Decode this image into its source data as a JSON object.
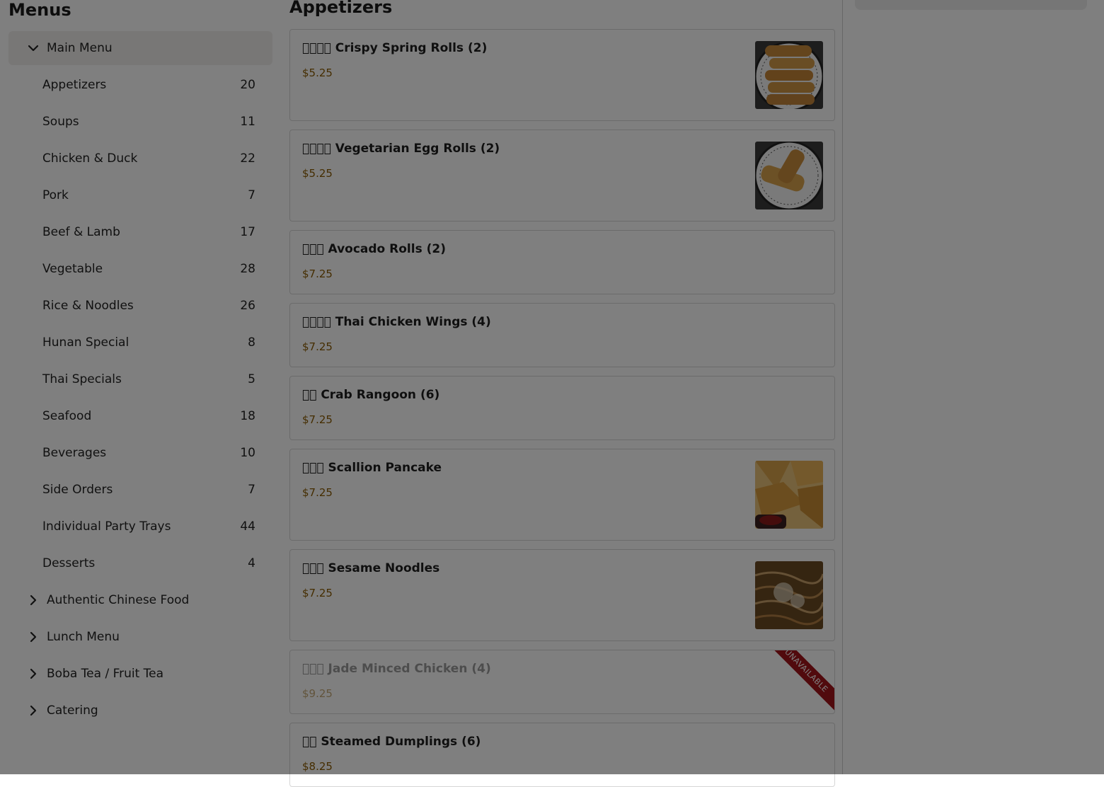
{
  "sidebar": {
    "title": "Menus",
    "main_menu_label": "Main Menu",
    "categories": [
      {
        "label": "Appetizers",
        "count": "20"
      },
      {
        "label": "Soups",
        "count": "11"
      },
      {
        "label": "Chicken & Duck",
        "count": "22"
      },
      {
        "label": "Pork",
        "count": "7"
      },
      {
        "label": "Beef & Lamb",
        "count": "17"
      },
      {
        "label": "Vegetable",
        "count": "28"
      },
      {
        "label": "Rice & Noodles",
        "count": "26"
      },
      {
        "label": "Hunan Special",
        "count": "8"
      },
      {
        "label": "Thai Specials",
        "count": "5"
      },
      {
        "label": "Seafood",
        "count": "18"
      },
      {
        "label": "Beverages",
        "count": "10"
      },
      {
        "label": "Side Orders",
        "count": "7"
      },
      {
        "label": "Individual Party Trays",
        "count": "44"
      },
      {
        "label": "Desserts",
        "count": "4"
      }
    ],
    "other_menus": [
      {
        "label": "Authentic Chinese Food"
      },
      {
        "label": "Lunch Menu"
      },
      {
        "label": "Boba Tea / Fruit Tea"
      },
      {
        "label": "Catering"
      }
    ]
  },
  "main": {
    "section_title": "Appetizers",
    "items": [
      {
        "name": "􏿾􏿾􏿾􏿾 Crispy Spring Rolls (2)",
        "price": "$5.25",
        "image": "spring-rolls"
      },
      {
        "name": "􏿾􏿾􏿾􏿾 Vegetarian Egg Rolls (2)",
        "price": "$5.25",
        "image": "egg-rolls"
      },
      {
        "name": "􏿾􏿾􏿾 Avocado Rolls (2)",
        "price": "$7.25"
      },
      {
        "name": "􏿾􏿾􏿾􏿾 Thai Chicken Wings (4)",
        "price": "$7.25"
      },
      {
        "name": "􏿾􏿾 Crab Rangoon (6)",
        "price": "$7.25"
      },
      {
        "name": "􏿾􏿾􏿾 Scallion Pancake",
        "price": "$7.25",
        "image": "scallion-pancake"
      },
      {
        "name": "􏿾􏿾􏿾 Sesame Noodles",
        "price": "$7.25",
        "image": "sesame-noodles"
      },
      {
        "name": "􏿾􏿾􏿾 Jade Minced Chicken (4)",
        "price": "$9.25",
        "badge": "UNAVAILABLE"
      },
      {
        "name": "􏿾􏿾 Steamed Dumplings (6)",
        "price": "$8.25"
      }
    ]
  },
  "colors": {
    "price": "#8a5a00",
    "unavailable_ribbon": "#a3151b",
    "selected_group_bg": "#f1efec",
    "overlay": "rgba(0,0,0,0.5)"
  }
}
